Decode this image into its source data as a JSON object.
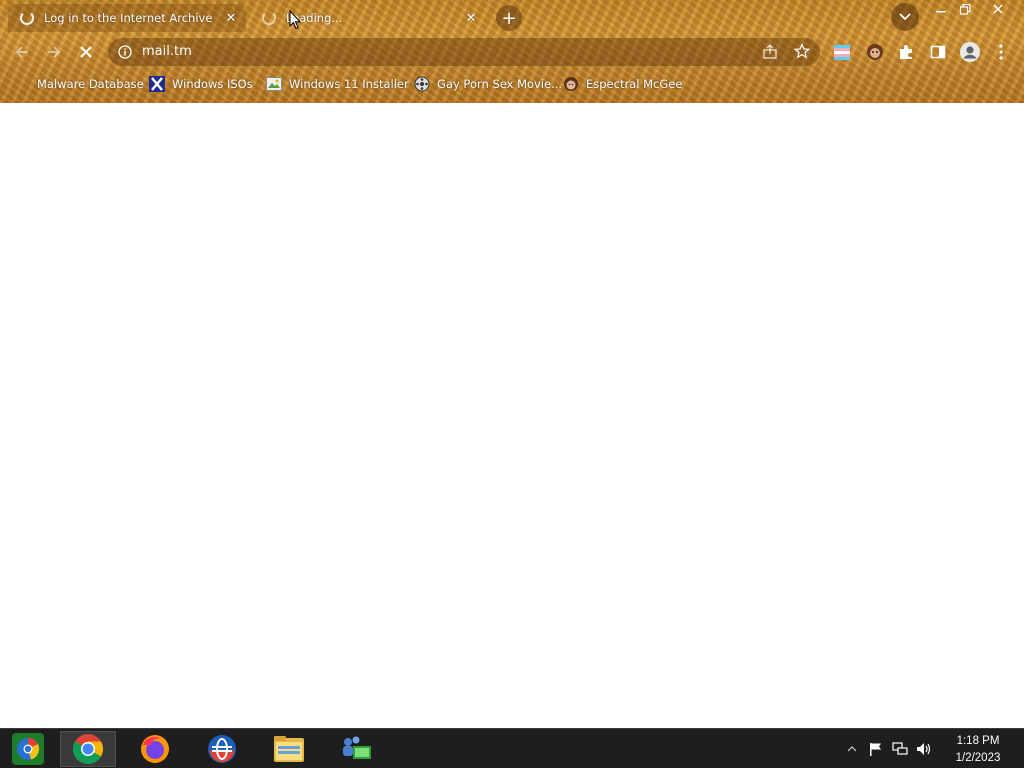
{
  "tabs": [
    {
      "title": "Log in to the Internet Archive",
      "state": "loading"
    },
    {
      "title": "Loading...",
      "state": "loading"
    }
  ],
  "omnibox": {
    "url": "mail.tm",
    "info_icon": "info-icon"
  },
  "bookmarks": [
    {
      "label": "Malware Database",
      "icon": "folder-favicon"
    },
    {
      "label": "Windows ISOs",
      "icon": "x-favicon"
    },
    {
      "label": "Windows 11 Installer",
      "icon": "image-favicon"
    },
    {
      "label": "Gay Porn Sex Movie...",
      "icon": "film-favicon"
    },
    {
      "label": "Espectral McGee",
      "icon": "face-favicon"
    }
  ],
  "taskbar": {
    "apps": [
      "start-orb",
      "chrome",
      "firefox",
      "opera",
      "file-explorer",
      "network-people"
    ],
    "clock": {
      "time": "1:18 PM",
      "date": "1/2/2023"
    }
  },
  "theme": {
    "accent": "#c98a2c",
    "taskbar": "#1e1e1e"
  }
}
